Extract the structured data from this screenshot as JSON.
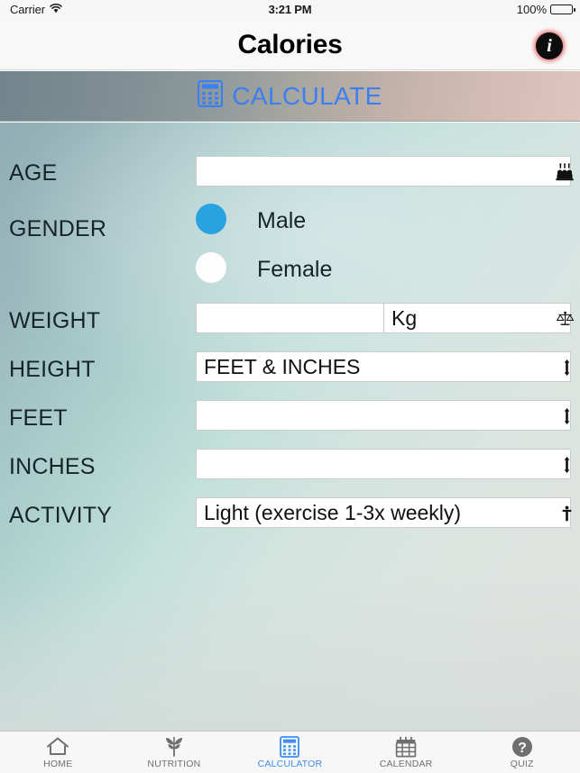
{
  "status_bar": {
    "carrier": "Carrier",
    "wifi_icon": "wifi-icon",
    "time": "3:21 PM",
    "battery_percent": "100%",
    "battery_icon": "battery-full-icon"
  },
  "nav_bar": {
    "title": "Calories",
    "info_button_glyph": "i",
    "info_icon": "info-circle-icon"
  },
  "calculate_banner": {
    "label": "CALCULATE",
    "icon": "calculator-icon",
    "color": "#3c7ff0"
  },
  "form": {
    "age": {
      "label": "AGE",
      "value": "",
      "placeholder": "",
      "icon": "birthday-cake-icon"
    },
    "gender": {
      "label": "GENDER",
      "selected": "Male",
      "options": [
        {
          "label": "Male",
          "selected": true
        },
        {
          "label": "Female",
          "selected": false
        }
      ],
      "selected_color": "#29a3e0",
      "unselected_color": "#fdfdfd"
    },
    "weight": {
      "label": "WEIGHT",
      "value": "",
      "placeholder": "",
      "unit": "Kg",
      "unit_icon": "balance-scale-icon"
    },
    "height": {
      "label": "HEIGHT",
      "value": "FEET & INCHES",
      "icon": "up-down-arrow-icon"
    },
    "feet": {
      "label": "FEET",
      "value": "",
      "icon": "up-down-arrow-icon"
    },
    "inches": {
      "label": "INCHES",
      "value": "",
      "icon": "up-down-arrow-icon"
    },
    "activity": {
      "label": "ACTIVITY",
      "value": "Light (exercise 1-3x weekly)",
      "icon": "person-running-icon"
    }
  },
  "tab_bar": {
    "active": "CALCULATOR",
    "active_color": "#3c8ef0",
    "inactive_color": "#6f6f6f",
    "items": [
      {
        "label": "HOME",
        "icon": "home-icon",
        "active": false
      },
      {
        "label": "NUTRITION",
        "icon": "leaf-icon",
        "active": false
      },
      {
        "label": "CALCULATOR",
        "icon": "calculator-icon",
        "active": true
      },
      {
        "label": "CALENDAR",
        "icon": "calendar-icon",
        "active": false
      },
      {
        "label": "QUIZ",
        "icon": "question-mark-circle-icon",
        "active": false
      }
    ]
  }
}
